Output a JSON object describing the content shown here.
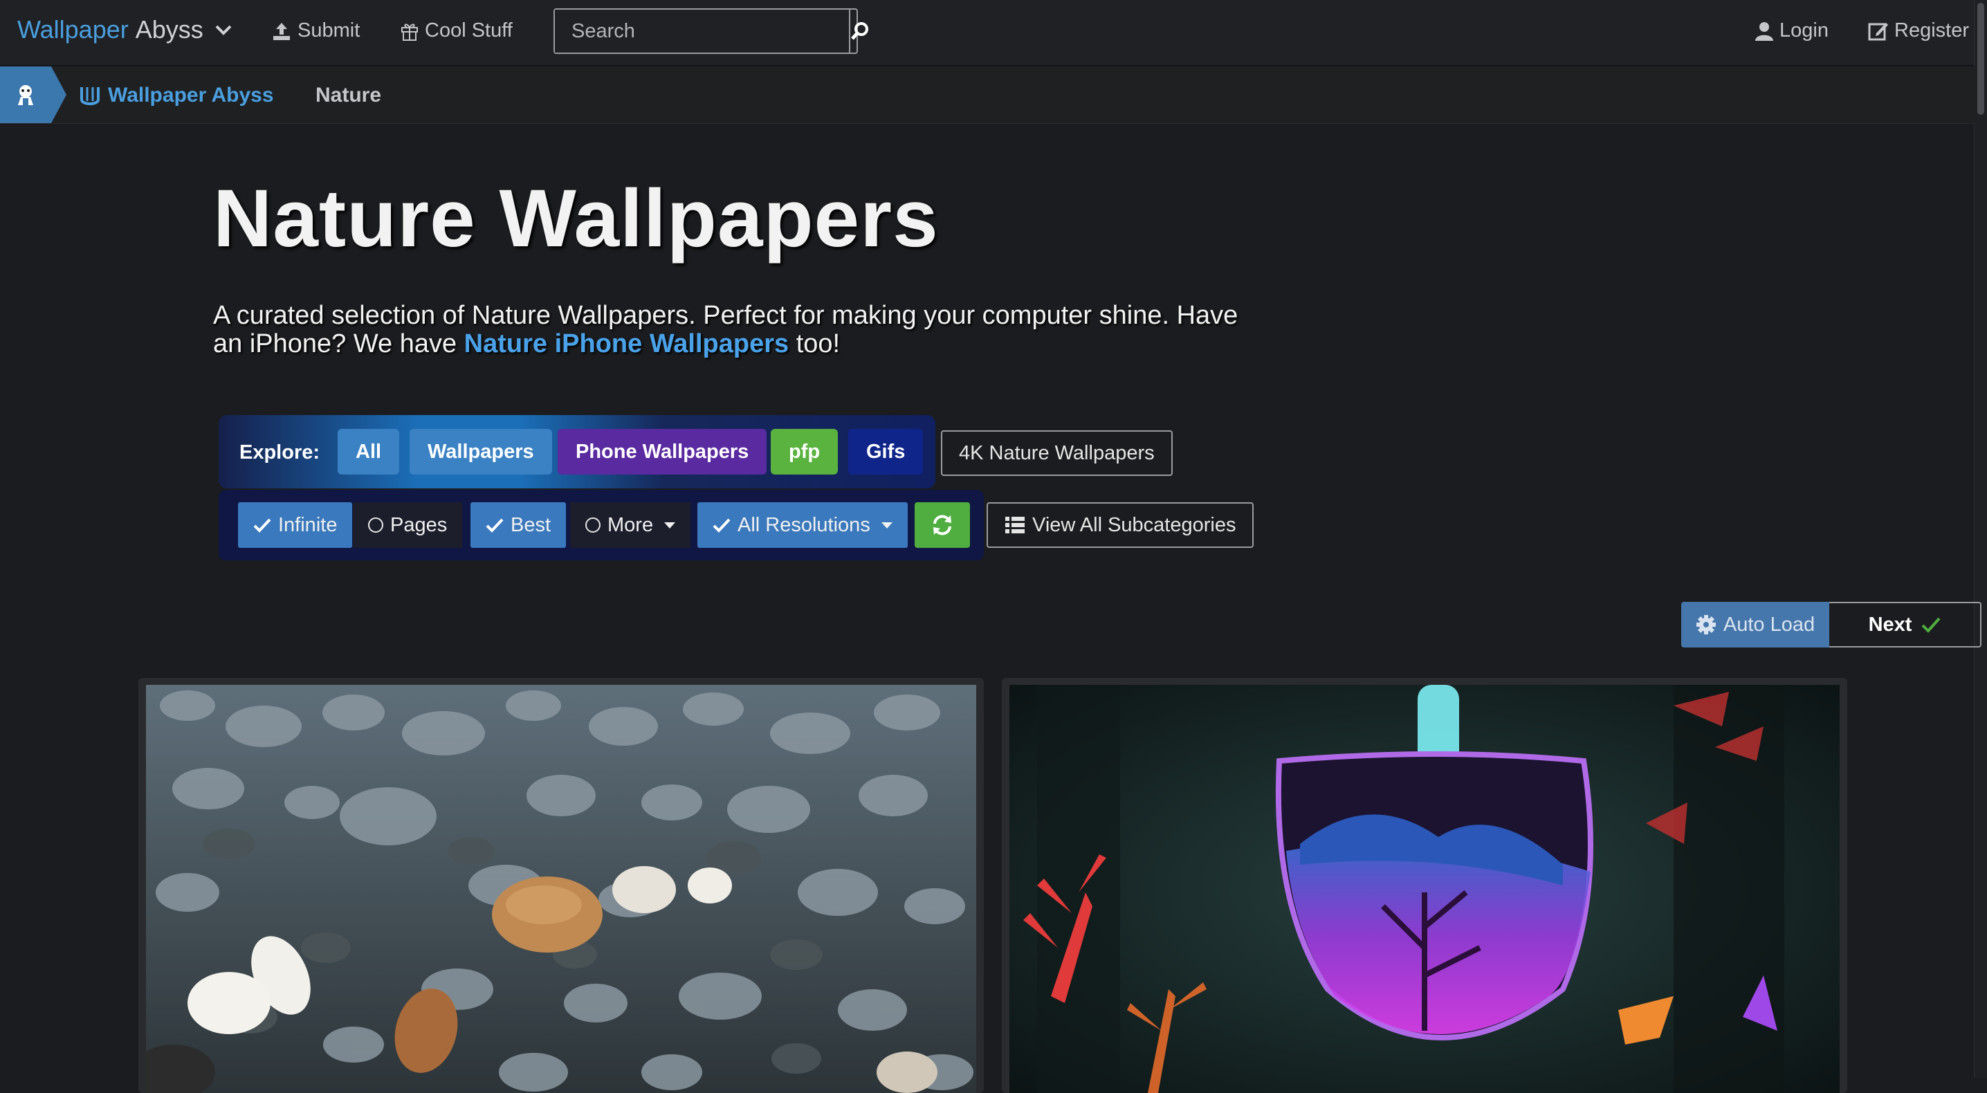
{
  "navbar": {
    "brand_main": "Wallpaper",
    "brand_sub": "Abyss",
    "submit_label": "Submit",
    "cool_stuff_label": "Cool Stuff",
    "search_placeholder": "Search",
    "login_label": "Login",
    "register_label": "Register"
  },
  "breadcrumb": {
    "site": "Wallpaper Abyss",
    "current": "Nature"
  },
  "header": {
    "title": "Nature Wallpapers",
    "desc_part1": "A curated selection of Nature Wallpapers. Perfect for making your computer shine. Have an iPhone? We have ",
    "desc_link": "Nature iPhone Wallpapers",
    "desc_part2": " too!"
  },
  "explore": {
    "label": "Explore:",
    "buttons": [
      "All",
      "Wallpapers",
      "Phone Wallpapers",
      "pfp",
      "Gifs"
    ],
    "link_4k": "4K Nature Wallpapers"
  },
  "options": {
    "infinite": "Infinite",
    "pages": "Pages",
    "best": "Best",
    "more": "More",
    "resolutions": "All Resolutions",
    "subcategories": "View All Subcategories"
  },
  "paging": {
    "auto_load": "Auto Load",
    "next": "Next"
  },
  "colors": {
    "accent": "#4a9fe0",
    "background": "#1b1c1f",
    "navbar": "#202124"
  }
}
